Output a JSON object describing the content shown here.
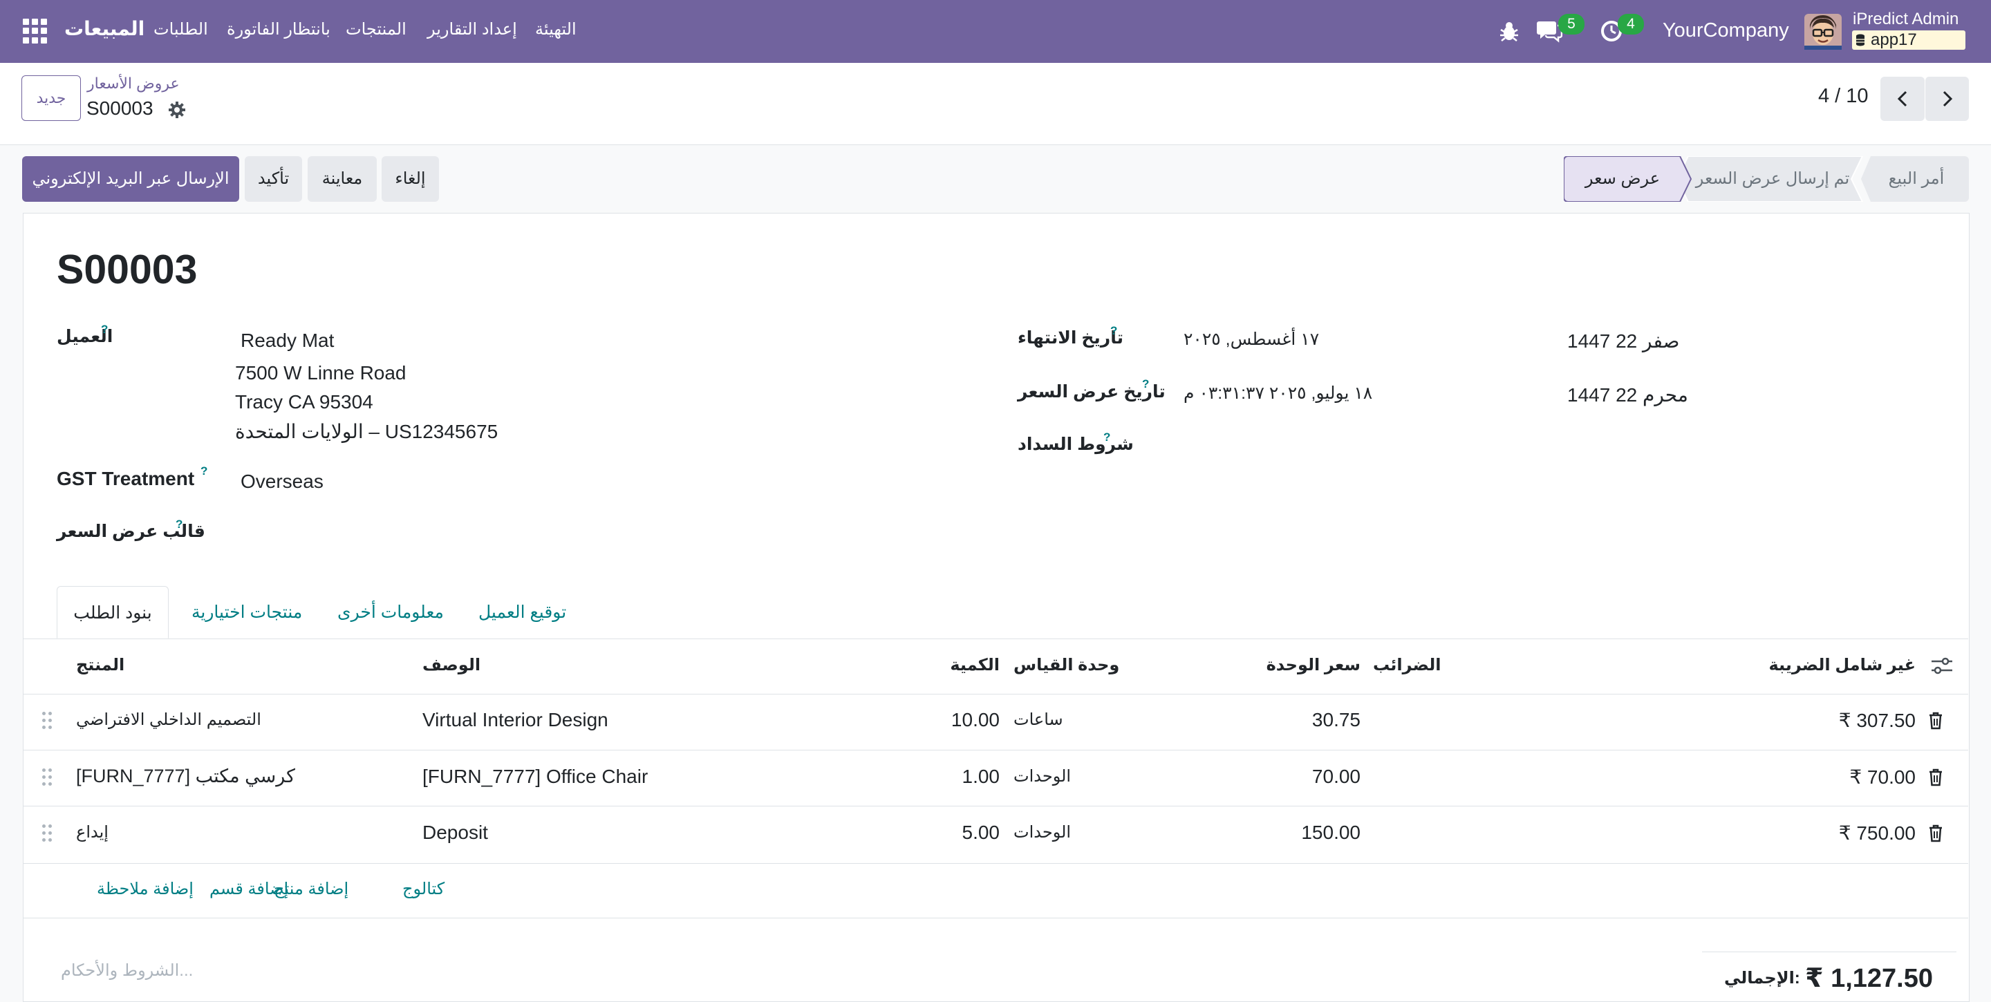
{
  "navbar": {
    "app_name": "المبيعات",
    "menu": [
      "الطلبات",
      "بانتظار الفاتورة",
      "المنتجات",
      "إعداد التقارير",
      "التهيئة"
    ],
    "messages_count": "5",
    "activities_count": "4",
    "company": "YourCompany",
    "user_name": "iPredict Admin",
    "database": "app17",
    "color": "#71639e"
  },
  "control": {
    "new_button": "جديد",
    "breadcrumb": "عروض الأسعار",
    "record_name": "S00003",
    "pager": "4 / 10"
  },
  "actions": {
    "send_email": "الإرسال عبر البريد الإلكتروني",
    "confirm": "تأكيد",
    "preview": "معاينة",
    "cancel": "إلغاء"
  },
  "statusbar": {
    "stages": [
      "عرض سعر",
      "تم إرسال عرض السعر",
      "أمر البيع"
    ],
    "active": "عرض سعر"
  },
  "form": {
    "title": "S00003",
    "customer_label": "العميل",
    "customer_name": "Ready Mat",
    "address_line1": "7500 W Linne Road",
    "address_line2": "Tracy CA 95304",
    "address_line3": "الولايات المتحدة – US12345675",
    "gst_label": "GST Treatment",
    "gst_value": "Overseas",
    "template_label": "قالب عرض السعر",
    "expiry_label": "تاريخ الانتهاء",
    "expiry_value": "١٧ أغسطس, ٢٠٢٥",
    "expiry_hijri": "صفر 22 1447",
    "quote_date_label": "تاريخ عرض السعر",
    "quote_date_value": "١٨ يوليو, ٢٠٢٥ ٠٣:٣١:٣٧ م",
    "quote_date_hijri": "محرم 22 1447",
    "payment_terms_label": "شروط السداد",
    "question_mark": "?"
  },
  "tabs": [
    "بنود الطلب",
    "منتجات اختيارية",
    "معلومات أخرى",
    "توقيع العميل"
  ],
  "table": {
    "headers": {
      "product": "المنتج",
      "description": "الوصف",
      "quantity": "الكمية",
      "uom": "وحدة القياس",
      "unit_price": "سعر الوحدة",
      "taxes": "الضرائب",
      "subtotal": "غير شامل الضريبة"
    },
    "rows": [
      {
        "product": "التصميم الداخلي الافتراضي",
        "description": "Virtual Interior Design",
        "quantity": "10.00",
        "uom": "ساعات",
        "unit_price": "30.75",
        "subtotal": "₹ 307.50"
      },
      {
        "product": "[FURN_7777] كرسي مكتب",
        "description": "[FURN_7777] Office Chair",
        "quantity": "1.00",
        "uom": "الوحدات",
        "unit_price": "70.00",
        "subtotal": "₹ 70.00"
      },
      {
        "product": "إيداع",
        "description": "Deposit",
        "quantity": "5.00",
        "uom": "الوحدات",
        "unit_price": "150.00",
        "subtotal": "₹ 750.00"
      }
    ],
    "add_product": "إضافة منتج",
    "add_section": "إضافة قسم",
    "add_note": "إضافة ملاحظة",
    "catalog": "كتالوج"
  },
  "footer": {
    "terms_placeholder": "الشروط والأحكام...",
    "total_label": "الإجمالي:",
    "total_value": "₹ 1,127.50"
  }
}
